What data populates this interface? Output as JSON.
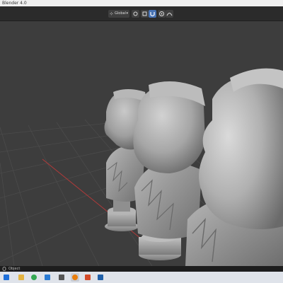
{
  "app": {
    "title": "Blender 4.0"
  },
  "toolbar": {
    "orientation_label": "Global",
    "icons": [
      "transform-orientation-icon",
      "pivot-icon",
      "snap-icon",
      "magnet-icon",
      "proportional-edit-icon",
      "falloff-icon"
    ]
  },
  "viewport": {
    "background_color": "#3d3d3d",
    "grid_color": "#4b4b4b",
    "x_axis_color": "#b23a3a",
    "object_color": "#9a9a9a"
  },
  "statusbar": {
    "label": "Object"
  },
  "taskbar": {
    "items": [
      {
        "icon": "windows-start-icon",
        "color": "#1e6fd9"
      },
      {
        "icon": "file-explorer-icon",
        "color": "#e3b341"
      },
      {
        "icon": "chrome-icon",
        "color": "#34a853"
      },
      {
        "icon": "app-icon",
        "color": "#2a7bd4"
      },
      {
        "icon": "app-icon",
        "color": "#555555"
      },
      {
        "icon": "blender-icon",
        "color": "#e87d0d"
      },
      {
        "icon": "zbrush-icon",
        "color": "#d44b2a"
      },
      {
        "icon": "app-icon",
        "color": "#1f5fa8"
      }
    ]
  }
}
